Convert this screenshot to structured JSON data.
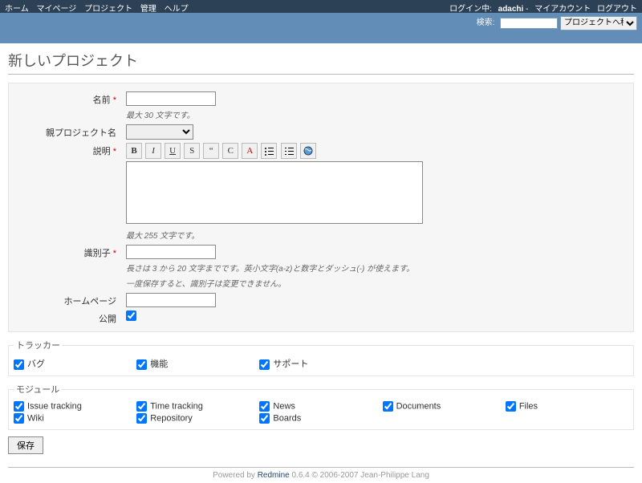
{
  "topmenu": {
    "left": [
      "ホーム",
      "マイページ",
      "プロジェクト",
      "管理",
      "ヘルプ"
    ],
    "login_label": "ログイン中:",
    "user": "adachi",
    "right": [
      "マイアカウント",
      "ログアウト"
    ]
  },
  "header": {
    "search_label": "検索:",
    "search_value": "",
    "jump_selected": "プロジェクトへ移動..."
  },
  "page_title": "新しいプロジェクト",
  "form": {
    "name": {
      "label": "名前",
      "value": "",
      "hint": "最大 30 文字です。"
    },
    "parent": {
      "label": "親プロジェクト名",
      "selected": ""
    },
    "description": {
      "label": "説明",
      "value": "",
      "hint": "最大 255 文字です。"
    },
    "identifier": {
      "label": "識別子",
      "value": "",
      "hint1": "長さは 3 から 20 文字までです。英小文字(a-z)と数字とダッシュ(-) が使えます。",
      "hint2": "一度保存すると、識別子は変更できません。"
    },
    "homepage": {
      "label": "ホームページ",
      "value": ""
    },
    "public": {
      "label": "公開",
      "checked": true
    }
  },
  "toolbar": {
    "bold": "B",
    "italic": "I",
    "underline": "U",
    "strike": "S",
    "quote": "“",
    "code": "C",
    "color": "A",
    "ul": "ul",
    "ol": "ol",
    "glob": "glob"
  },
  "trackers": {
    "legend": "トラッカー",
    "items": [
      {
        "label": "バグ",
        "checked": true
      },
      {
        "label": "機能",
        "checked": true
      },
      {
        "label": "サポート",
        "checked": true
      }
    ]
  },
  "modules": {
    "legend": "モジュール",
    "items": [
      {
        "label": "Issue tracking",
        "checked": true
      },
      {
        "label": "Time tracking",
        "checked": true
      },
      {
        "label": "News",
        "checked": true
      },
      {
        "label": "Documents",
        "checked": true
      },
      {
        "label": "Files",
        "checked": true
      },
      {
        "label": "Wiki",
        "checked": true
      },
      {
        "label": "Repository",
        "checked": true
      },
      {
        "label": "Boards",
        "checked": true
      }
    ]
  },
  "save_label": "保存",
  "footer": {
    "prefix": "Powered by ",
    "link": "Redmine",
    "suffix": " 0.6.4 © 2006-2007 Jean-Philippe Lang"
  }
}
